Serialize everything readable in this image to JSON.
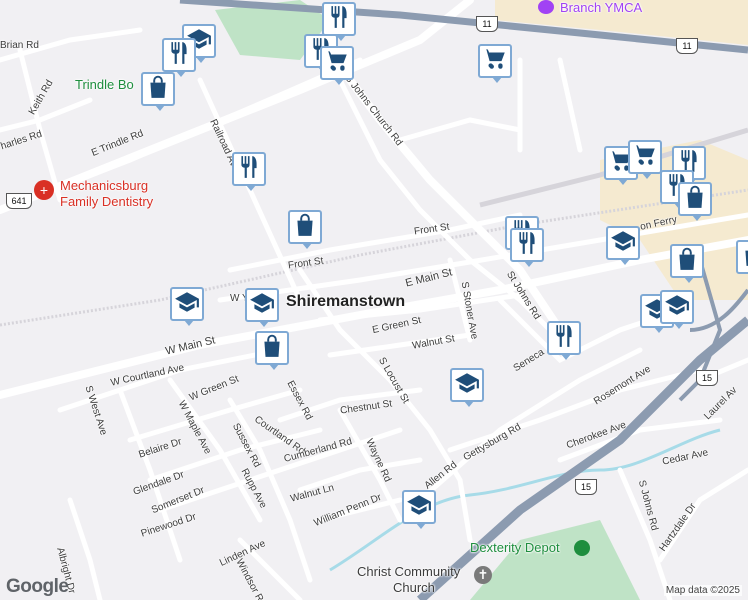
{
  "colors": {
    "background": "#f1f0f3",
    "road": "#ffffff",
    "highway": "#8c9bb0",
    "pin_fill": "#1f4e79",
    "pin_border": "#7fa9d4",
    "park": "#bfe3c6",
    "water": "#a7dbe8",
    "commercial": "#f5ead0",
    "poi_green": "#1e8e3e",
    "poi_red": "#d93025",
    "poi_purple": "#a142f4"
  },
  "labels": {
    "town": "Shiremanstown",
    "roads": {
      "brian_rd": "Brian Rd",
      "keith_rd": "Keith Rd",
      "charles_rd": "harles Rd",
      "e_trindle_rd": "E Trindle Rd",
      "railroad_ave": "Railroad Ave",
      "s_johns_church_rd": "S Johns Church Rd",
      "front_st_1": "Front St",
      "front_st_2": "Front St",
      "e_main_st": "E Main St",
      "w_main_st": "W Main St",
      "e_green_st": "E Green St",
      "walnut_st": "Walnut St",
      "s_stoner_ave": "S Stoner Ave",
      "st_johns_rd": "St Johns Rd",
      "w_courtland_ave": "W Courtland Ave",
      "w_green_st": "W Green St",
      "s_west_ave": "S West Ave",
      "essex_rd": "Essex Rd",
      "courtland_rd": "Courtland Rd",
      "s_locust_st": "S Locust St",
      "chestnut_st": "Chestnut St",
      "cumberland_rd": "Cumberland Rd",
      "wayne_rd": "Wayne Rd",
      "w_maple_ave": "W Maple Ave",
      "belaire_dr": "Belaire Dr",
      "glendale_dr": "Glendale Dr",
      "somerset_dr": "Somerset Dr",
      "sussex_rd": "Sussex Rd",
      "pinewood_dr": "Pinewood Dr",
      "rupp_ave": "Rupp Ave",
      "walnut_ln": "Walnut Ln",
      "william_penn_dr": "William Penn Dr",
      "allen_rd": "Allen Rd",
      "gettysburg_rd": "Gettysburg Rd",
      "seneca": "Seneca",
      "rosemont_ave": "Rosemont Ave",
      "cherokee_ave": "Cherokee Ave",
      "cedar_ave": "Cedar Ave",
      "laurel_ave": "Laurel Av",
      "s_johns_rd": "S Johns Rd",
      "hartzdale_dr": "Hartzdale Dr",
      "linden_ave": "Linden Ave",
      "windsor": "Windsor R",
      "albright_dr": "Albright Dr",
      "lemon_ferry": "on Ferry",
      "w_y": "W Y"
    },
    "pois": {
      "branch_ymca": "Branch YMCA",
      "trindle_bowl": "Trindle Bo",
      "mechanicsburg_family_dentistry_l1": "Mechanicsburg",
      "mechanicsburg_family_dentistry_l2": "Family Dentistry",
      "dexterity_depot": "Dexterity Depot",
      "christ_community_church_l1": "Christ Community",
      "christ_community_church_l2": "Church"
    },
    "shields": {
      "us11_a": "11",
      "us11_b": "11",
      "us641": "641",
      "us15_a": "15",
      "us15_b": "15"
    },
    "google": "Google",
    "attribution": "Map data ©2025"
  },
  "markers": [
    {
      "type": "restaurant-icon"
    },
    {
      "type": "restaurant-icon"
    },
    {
      "type": "school-icon"
    },
    {
      "type": "restaurant-icon"
    },
    {
      "type": "cart-icon"
    },
    {
      "type": "cart-icon"
    },
    {
      "type": "bag-icon"
    },
    {
      "type": "restaurant-icon"
    },
    {
      "type": "bag-icon"
    },
    {
      "type": "restaurant-icon"
    },
    {
      "type": "restaurant-icon"
    },
    {
      "type": "school-icon"
    },
    {
      "type": "school-icon"
    },
    {
      "type": "school-icon"
    },
    {
      "type": "bag-icon"
    },
    {
      "type": "restaurant-icon"
    },
    {
      "type": "school-icon"
    },
    {
      "type": "bag-icon"
    },
    {
      "type": "cart-icon"
    },
    {
      "type": "cart-icon"
    },
    {
      "type": "restaurant-icon"
    },
    {
      "type": "restaurant-icon"
    },
    {
      "type": "bag-icon"
    },
    {
      "type": "school-icon"
    },
    {
      "type": "bag-icon"
    },
    {
      "type": "school-icon"
    },
    {
      "type": "school-icon"
    }
  ]
}
